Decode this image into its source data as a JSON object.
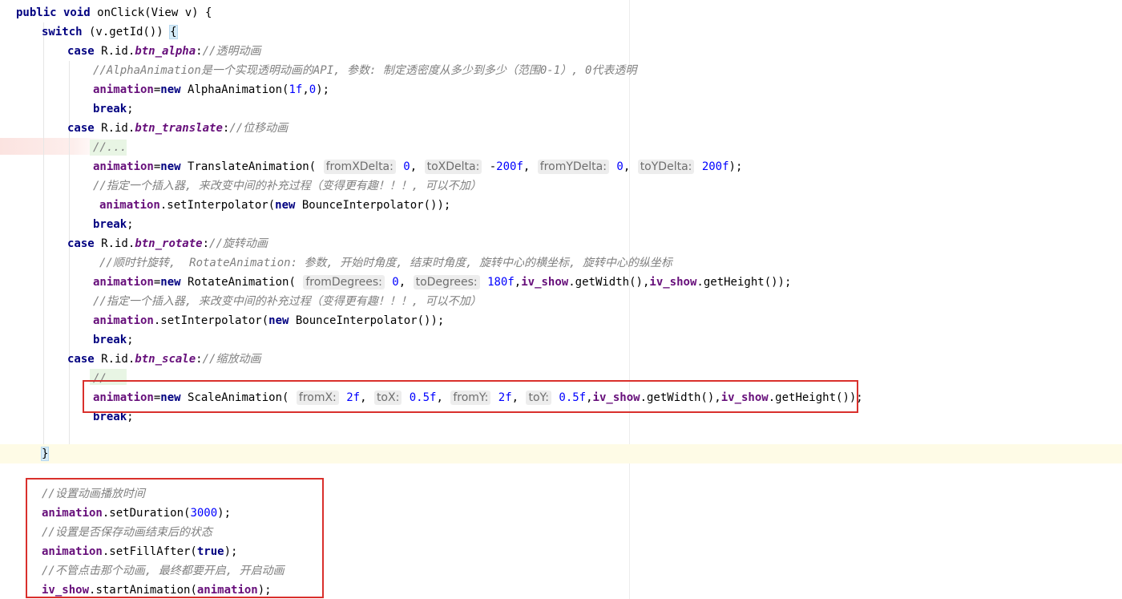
{
  "lines": [
    {
      "tokens": [
        {
          "t": "kw",
          "v": "public void"
        },
        {
          "t": "p",
          "v": " onClick(View v) {"
        }
      ]
    },
    {
      "tokens": [
        {
          "t": "kw",
          "v": "switch"
        },
        {
          "t": "p",
          "v": " (v.getId()) "
        },
        {
          "t": "brace",
          "v": "{"
        }
      ]
    },
    {
      "tokens": [
        {
          "t": "kw",
          "v": "case"
        },
        {
          "t": "p",
          "v": " R.id."
        },
        {
          "t": "field",
          "v": "btn_alpha"
        },
        {
          "t": "p",
          "v": ":"
        },
        {
          "t": "cmt",
          "v": "//透明动画"
        }
      ]
    },
    {
      "tokens": [
        {
          "t": "cmt",
          "v": "//AlphaAnimation是一个实现透明动画的API, 参数: 制定透密度从多少到多少（范围0-1）, 0代表透明"
        }
      ]
    },
    {
      "tokens": [
        {
          "t": "var",
          "v": "animation"
        },
        {
          "t": "p",
          "v": "="
        },
        {
          "t": "kw",
          "v": "new"
        },
        {
          "t": "p",
          "v": " AlphaAnimation("
        },
        {
          "t": "num",
          "v": "1f"
        },
        {
          "t": "p",
          "v": ","
        },
        {
          "t": "num",
          "v": "0"
        },
        {
          "t": "p",
          "v": ");"
        }
      ]
    },
    {
      "tokens": [
        {
          "t": "kw",
          "v": "break"
        },
        {
          "t": "p",
          "v": ";"
        }
      ]
    },
    {
      "tokens": [
        {
          "t": "kw",
          "v": "case"
        },
        {
          "t": "p",
          "v": " R.id."
        },
        {
          "t": "field",
          "v": "btn_translate"
        },
        {
          "t": "p",
          "v": ":"
        },
        {
          "t": "cmt",
          "v": "//位移动画"
        }
      ]
    },
    {
      "tokens": [
        {
          "t": "cmt",
          "v": "//..."
        }
      ]
    },
    {
      "tokens": [
        {
          "t": "var",
          "v": "animation"
        },
        {
          "t": "p",
          "v": "="
        },
        {
          "t": "kw",
          "v": "new"
        },
        {
          "t": "p",
          "v": " TranslateAnimation( "
        },
        {
          "t": "hint",
          "v": "fromXDelta:"
        },
        {
          "t": "p",
          "v": " "
        },
        {
          "t": "num",
          "v": "0"
        },
        {
          "t": "p",
          "v": ", "
        },
        {
          "t": "hint",
          "v": "toXDelta:"
        },
        {
          "t": "p",
          "v": " -"
        },
        {
          "t": "num",
          "v": "200f"
        },
        {
          "t": "p",
          "v": ", "
        },
        {
          "t": "hint",
          "v": "fromYDelta:"
        },
        {
          "t": "p",
          "v": " "
        },
        {
          "t": "num",
          "v": "0"
        },
        {
          "t": "p",
          "v": ", "
        },
        {
          "t": "hint",
          "v": "toYDelta:"
        },
        {
          "t": "p",
          "v": " "
        },
        {
          "t": "num",
          "v": "200f"
        },
        {
          "t": "p",
          "v": ");"
        }
      ]
    },
    {
      "tokens": [
        {
          "t": "cmt",
          "v": "//指定一个插入器, 来改变中间的补充过程（变得更有趣！！！, 可以不加）"
        }
      ]
    },
    {
      "tokens": [
        {
          "t": "var",
          "v": "animation"
        },
        {
          "t": "p",
          "v": ".setInterpolator("
        },
        {
          "t": "kw",
          "v": "new"
        },
        {
          "t": "p",
          "v": " BounceInterpolator());"
        }
      ]
    },
    {
      "tokens": [
        {
          "t": "kw",
          "v": "break"
        },
        {
          "t": "p",
          "v": ";"
        }
      ]
    },
    {
      "tokens": [
        {
          "t": "kw",
          "v": "case"
        },
        {
          "t": "p",
          "v": " R.id."
        },
        {
          "t": "field",
          "v": "btn_rotate"
        },
        {
          "t": "p",
          "v": ":"
        },
        {
          "t": "cmt",
          "v": "//旋转动画"
        }
      ]
    },
    {
      "tokens": [
        {
          "t": "cmt",
          "v": "//顺时针旋转,  RotateAnimation: 参数, 开始时角度, 结束时角度, 旋转中心的横坐标, 旋转中心的纵坐标"
        }
      ]
    },
    {
      "tokens": [
        {
          "t": "var",
          "v": "animation"
        },
        {
          "t": "p",
          "v": "="
        },
        {
          "t": "kw",
          "v": "new"
        },
        {
          "t": "p",
          "v": " RotateAnimation( "
        },
        {
          "t": "hint",
          "v": "fromDegrees:"
        },
        {
          "t": "p",
          "v": " "
        },
        {
          "t": "num",
          "v": "0"
        },
        {
          "t": "p",
          "v": ", "
        },
        {
          "t": "hint",
          "v": "toDegrees:"
        },
        {
          "t": "p",
          "v": " "
        },
        {
          "t": "num",
          "v": "180f"
        },
        {
          "t": "p",
          "v": ","
        },
        {
          "t": "var",
          "v": "iv_show"
        },
        {
          "t": "p",
          "v": ".getWidth(),"
        },
        {
          "t": "var",
          "v": "iv_show"
        },
        {
          "t": "p",
          "v": ".getHeight());"
        }
      ]
    },
    {
      "tokens": [
        {
          "t": "cmt",
          "v": "//指定一个插入器, 来改变中间的补充过程（变得更有趣！！！, 可以不加）"
        }
      ]
    },
    {
      "tokens": [
        {
          "t": "var",
          "v": "animation"
        },
        {
          "t": "p",
          "v": ".setInterpolator("
        },
        {
          "t": "kw",
          "v": "new"
        },
        {
          "t": "p",
          "v": " BounceInterpolator());"
        }
      ]
    },
    {
      "tokens": [
        {
          "t": "kw",
          "v": "break"
        },
        {
          "t": "p",
          "v": ";"
        }
      ]
    },
    {
      "tokens": [
        {
          "t": "kw",
          "v": "case"
        },
        {
          "t": "p",
          "v": " R.id."
        },
        {
          "t": "field",
          "v": "btn_scale"
        },
        {
          "t": "p",
          "v": ":"
        },
        {
          "t": "cmt",
          "v": "//缩放动画"
        }
      ]
    },
    {
      "tokens": [
        {
          "t": "cmt",
          "v": "//"
        }
      ]
    },
    {
      "tokens": [
        {
          "t": "var",
          "v": "animation"
        },
        {
          "t": "p",
          "v": "="
        },
        {
          "t": "kw",
          "v": "new"
        },
        {
          "t": "p",
          "v": " ScaleAnimation( "
        },
        {
          "t": "hint",
          "v": "fromX:"
        },
        {
          "t": "p",
          "v": " "
        },
        {
          "t": "num",
          "v": "2f"
        },
        {
          "t": "p",
          "v": ", "
        },
        {
          "t": "hint",
          "v": "toX:"
        },
        {
          "t": "p",
          "v": " "
        },
        {
          "t": "num",
          "v": "0.5f"
        },
        {
          "t": "p",
          "v": ", "
        },
        {
          "t": "hint",
          "v": "fromY:"
        },
        {
          "t": "p",
          "v": " "
        },
        {
          "t": "num",
          "v": "2f"
        },
        {
          "t": "p",
          "v": ", "
        },
        {
          "t": "hint",
          "v": "toY:"
        },
        {
          "t": "p",
          "v": " "
        },
        {
          "t": "num",
          "v": "0.5f"
        },
        {
          "t": "p",
          "v": ","
        },
        {
          "t": "var",
          "v": "iv_show"
        },
        {
          "t": "p",
          "v": ".getWidth(),"
        },
        {
          "t": "var",
          "v": "iv_show"
        },
        {
          "t": "p",
          "v": ".getHeight());"
        }
      ]
    },
    {
      "tokens": [
        {
          "t": "kw",
          "v": "break"
        },
        {
          "t": "p",
          "v": ";"
        }
      ]
    },
    {
      "tokens": []
    },
    {
      "tokens": [
        {
          "t": "brace",
          "v": "}"
        }
      ]
    },
    {
      "tokens": []
    },
    {
      "tokens": [
        {
          "t": "cmt",
          "v": "//设置动画播放时间"
        }
      ]
    },
    {
      "tokens": [
        {
          "t": "var",
          "v": "animation"
        },
        {
          "t": "p",
          "v": ".setDuration("
        },
        {
          "t": "num",
          "v": "3000"
        },
        {
          "t": "p",
          "v": ");"
        }
      ]
    },
    {
      "tokens": [
        {
          "t": "cmt",
          "v": "//设置是否保存动画结束后的状态"
        }
      ]
    },
    {
      "tokens": [
        {
          "t": "var",
          "v": "animation"
        },
        {
          "t": "p",
          "v": ".setFillAfter("
        },
        {
          "t": "kw",
          "v": "true"
        },
        {
          "t": "p",
          "v": ");"
        }
      ]
    },
    {
      "tokens": [
        {
          "t": "cmt",
          "v": "//不管点击那个动画, 最终都要开启, 开启动画"
        }
      ]
    },
    {
      "tokens": [
        {
          "t": "var",
          "v": "iv_show"
        },
        {
          "t": "p",
          "v": ".startAnimation("
        },
        {
          "t": "var",
          "v": "animation"
        },
        {
          "t": "p",
          "v": ");"
        }
      ]
    }
  ]
}
